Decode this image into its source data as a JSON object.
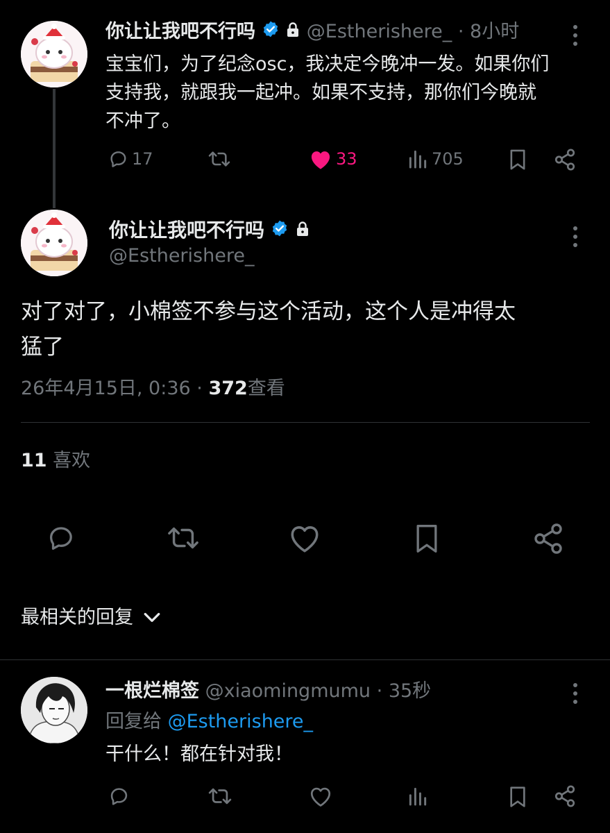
{
  "tweet1": {
    "display_name": "你让让我吧不行吗",
    "handle": "@Estherishere_",
    "time_sep": "·",
    "time": "8小时",
    "text_line1": "宝宝们，为了纪念osc，我决定今晚冲一发。如果你们",
    "text_line2": "支持我，就跟我一起冲。如果不支持，那你们今晚就",
    "text_line3": "不冲了。",
    "replies": "17",
    "likes": "33",
    "views": "705"
  },
  "tweet2": {
    "display_name": "你让让我吧不行吗",
    "handle": "@Estherishere_",
    "text_line1": "对了对了，小棉签不参与这个活动，这个人是冲得太",
    "text_line2": "猛了",
    "date": "26年4月15日, 0:36 · ",
    "view_count": "372",
    "view_label": "查看",
    "like_count": "11",
    "like_label": "喜欢"
  },
  "replies_sort": {
    "label": "最相关的回复"
  },
  "reply": {
    "display_name": "一根烂棉签",
    "handle": "@xiaomingmumu",
    "time_sep": "·",
    "time": "35秒",
    "reply_to_label": "回复给",
    "reply_to_handle": "@Estherishere_",
    "text": "干什么！都在针对我！"
  },
  "colors": {
    "background": "#000000",
    "text": "#e7e9ea",
    "muted": "#71767b",
    "like_active": "#f91880",
    "link": "#1d9bf0",
    "verified": "#1d9bf0"
  }
}
